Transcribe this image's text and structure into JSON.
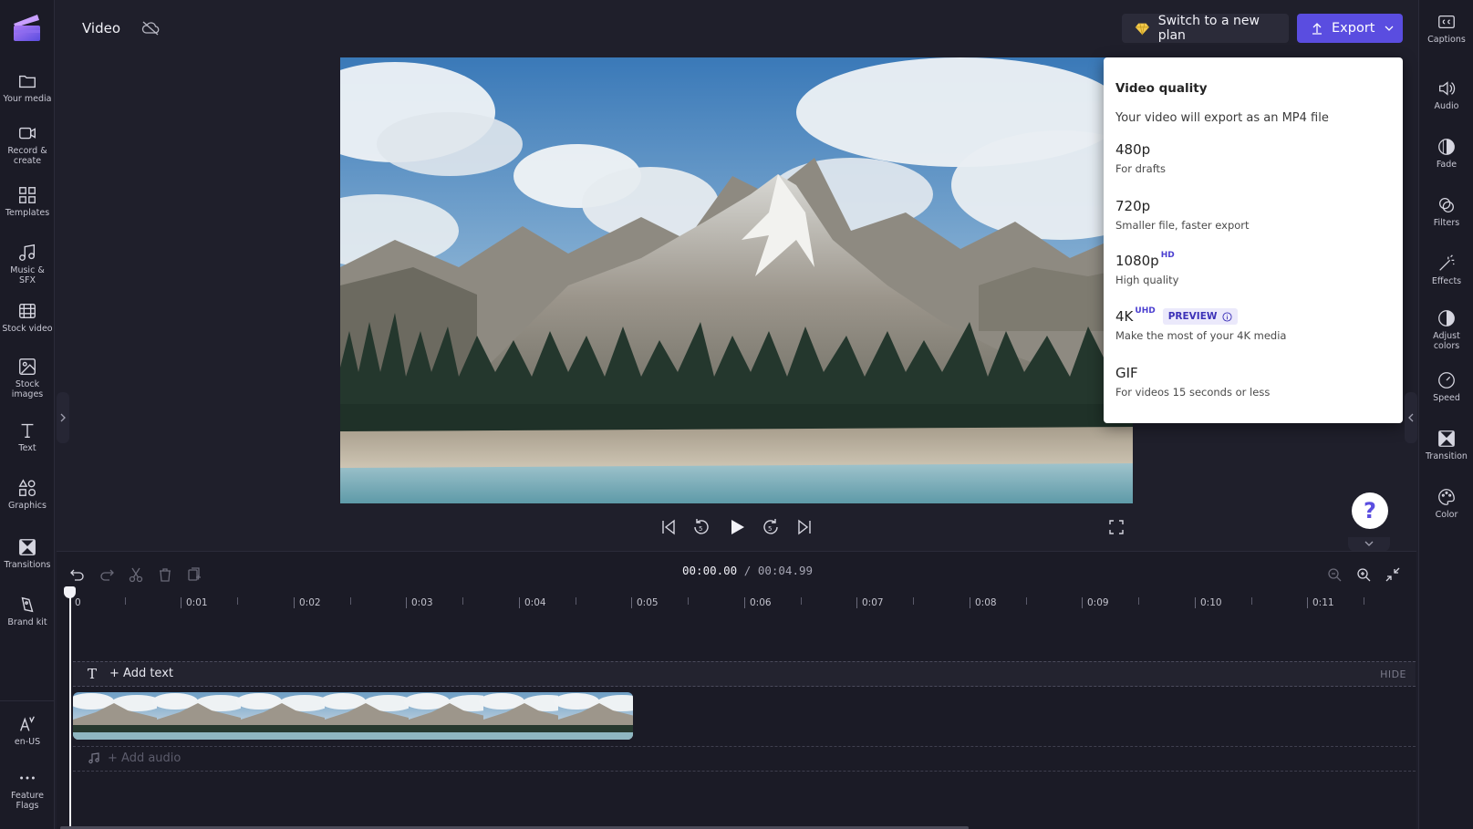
{
  "header": {
    "title": "Video",
    "plan_button": "Switch to a new plan",
    "export_button": "Export"
  },
  "left_nav": [
    {
      "label": "Your media",
      "icon": "folder-icon"
    },
    {
      "label": "Record & create",
      "icon": "camera-icon"
    },
    {
      "label": "Templates",
      "icon": "templates-icon"
    },
    {
      "label": "Music & SFX",
      "icon": "music-icon"
    },
    {
      "label": "Stock video",
      "icon": "film-icon"
    },
    {
      "label": "Stock images",
      "icon": "image-icon"
    },
    {
      "label": "Text",
      "icon": "text-icon"
    },
    {
      "label": "Graphics",
      "icon": "shapes-icon"
    },
    {
      "label": "Transitions",
      "icon": "transition-icon"
    },
    {
      "label": "Brand kit",
      "icon": "brand-kit-icon"
    },
    {
      "label": "en-US",
      "icon": "language-icon"
    },
    {
      "label": "Feature Flags",
      "icon": "more-icon"
    }
  ],
  "right_nav": [
    {
      "label": "Captions",
      "icon": "captions-icon"
    },
    {
      "label": "Audio",
      "icon": "speaker-icon"
    },
    {
      "label": "Fade",
      "icon": "fade-icon"
    },
    {
      "label": "Filters",
      "icon": "filters-icon"
    },
    {
      "label": "Effects",
      "icon": "magic-wand-icon"
    },
    {
      "label": "Adjust colors",
      "icon": "contrast-icon"
    },
    {
      "label": "Speed",
      "icon": "speedometer-icon"
    },
    {
      "label": "Transition",
      "icon": "transition-icon"
    },
    {
      "label": "Color",
      "icon": "palette-icon"
    }
  ],
  "export_menu": {
    "heading": "Video quality",
    "subheading": "Your video will export as an MP4 file",
    "options": [
      {
        "name": "480p",
        "badge": "",
        "desc": "For drafts"
      },
      {
        "name": "720p",
        "badge": "",
        "desc": "Smaller file, faster export"
      },
      {
        "name": "1080p",
        "badge": "HD",
        "desc": "High quality"
      },
      {
        "name": "4K",
        "badge": "UHD",
        "tag": "PREVIEW",
        "desc": "Make the most of your 4K media"
      },
      {
        "name": "GIF",
        "badge": "",
        "desc": "For videos 15 seconds or less"
      }
    ]
  },
  "timeline": {
    "current_time": "00:00.00",
    "separator": "/",
    "duration": "00:04.99",
    "ticks": [
      "0",
      "0:01",
      "0:02",
      "0:03",
      "0:04",
      "0:05",
      "0:06",
      "0:07",
      "0:08",
      "0:09",
      "0:10",
      "0:11"
    ],
    "add_text": "+ Add text",
    "hide": "HIDE",
    "add_audio": "+ Add audio"
  },
  "help": "?",
  "colors": {
    "accent": "#5a4de0",
    "background": "#1f1f2b"
  }
}
